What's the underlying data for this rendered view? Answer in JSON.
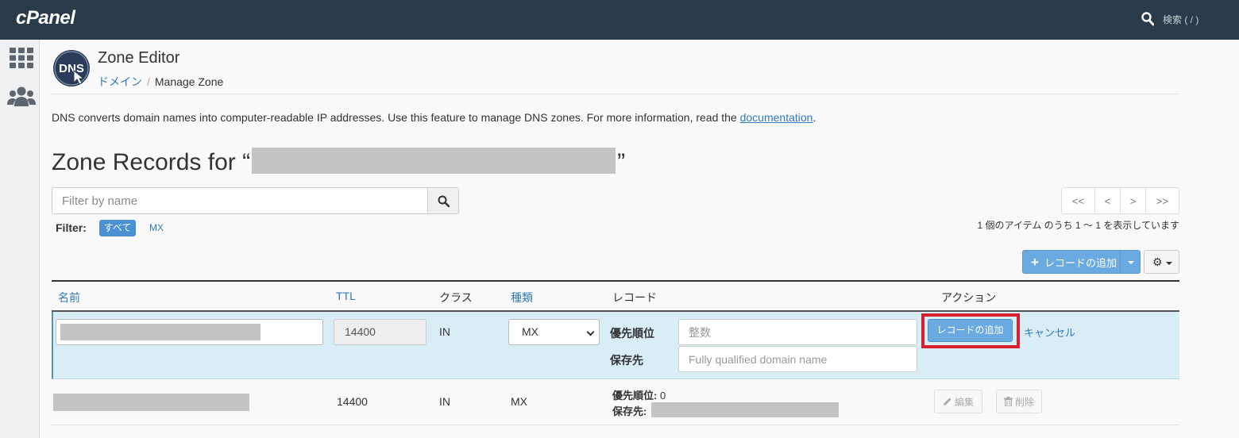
{
  "topbar": {
    "logo": "cPanel",
    "search_label": "検索 ( / )",
    "background": "#293a4a"
  },
  "sidebar": {
    "icons": [
      "grid-icon",
      "users-icon"
    ]
  },
  "header": {
    "app_icon": "dns-icon",
    "app_icon_text": "DNS",
    "title": "Zone Editor",
    "breadcrumb": [
      {
        "label": "ドメイン",
        "link": true
      },
      {
        "label": "Manage Zone",
        "link": false
      }
    ]
  },
  "description": {
    "text": "DNS converts domain names into computer-readable IP addresses. Use this feature to manage DNS zones. For more information, read the ",
    "link_text": "documentation",
    "suffix": "."
  },
  "zone": {
    "title_prefix": "Zone Records for “",
    "title_suffix": "”"
  },
  "filter": {
    "placeholder": "Filter by name",
    "label": "Filter:",
    "options": [
      "すべて",
      "MX"
    ],
    "active": "すべて"
  },
  "pagination": {
    "first": "<<",
    "prev": "<",
    "next": ">",
    "last": ">>",
    "info": "1 個のアイテム のうち 1 ～ 1 を表示しています"
  },
  "toolbar": {
    "add_record_label": "レコードの追加",
    "settings_icon": "gear-icon",
    "accent": "#6aaae0"
  },
  "table": {
    "headers": {
      "name": "名前",
      "ttl": "TTL",
      "class": "クラス",
      "type": "種類",
      "record": "レコード",
      "action": "アクション"
    },
    "edit_row": {
      "ttl_value": "14400",
      "class_value": "IN",
      "type_selected": "MX",
      "priority_label": "優先順位",
      "priority_placeholder": "整数",
      "destination_label": "保存先",
      "destination_placeholder": "Fully qualified domain name",
      "add_button": "レコードの追加",
      "cancel_link": "キャンセル",
      "highlight_color": "#d9202f",
      "row_background": "#d9edf7"
    },
    "rows": [
      {
        "ttl": "14400",
        "class": "IN",
        "type": "MX",
        "priority_label": "優先順位:",
        "priority_value": "0",
        "destination_label": "保存先:",
        "edit_label": "編集",
        "delete_label": "削除"
      }
    ]
  }
}
